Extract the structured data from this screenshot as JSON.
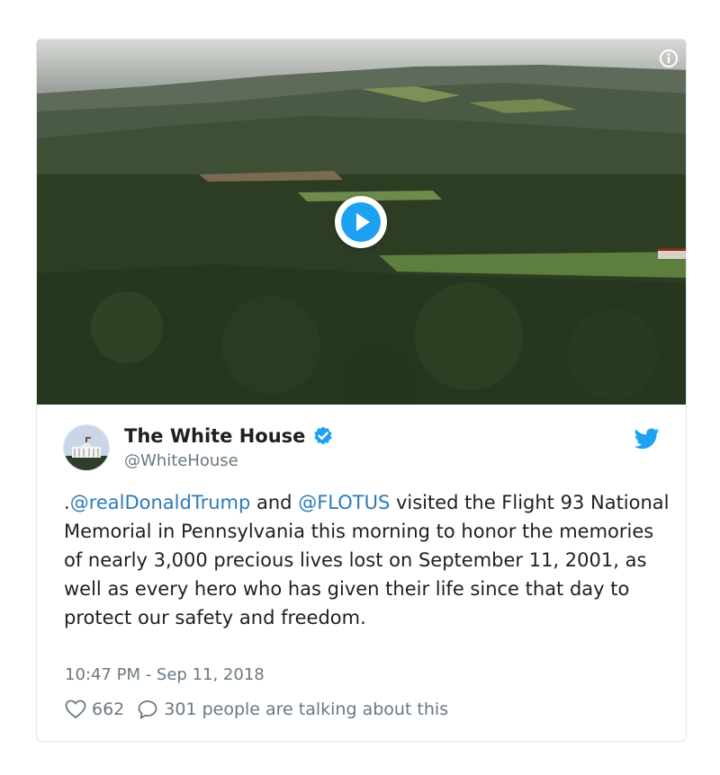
{
  "tweet": {
    "author": {
      "display_name": "The White House",
      "handle": "@WhiteHouse",
      "verified": true,
      "avatar": "white-house-avatar"
    },
    "text_parts": [
      ".",
      "@realDonaldTrump",
      " and ",
      "@FLOTUS",
      " visited the Flight 93 National Memorial in Pennsylvania this morning to honor the memories of nearly 3,000 precious lives lost on September 11, 2001, as well as every hero who has given their life since that day to protect our safety and freedom."
    ],
    "timestamp": "10:47 PM - Sep 11, 2018",
    "likes": "662",
    "conversation": "301 people are talking about this"
  },
  "media": {
    "type": "video",
    "play_icon": "play-icon",
    "info_icon": "info-icon"
  },
  "icons": {
    "brand": "twitter-bird-icon",
    "verified": "verified-badge-icon",
    "like": "heart-icon",
    "reply": "speech-bubble-icon"
  },
  "colors": {
    "link": "#2b7bb9",
    "brand": "#1da1f2",
    "muted": "#697882",
    "text": "#1c2022"
  }
}
